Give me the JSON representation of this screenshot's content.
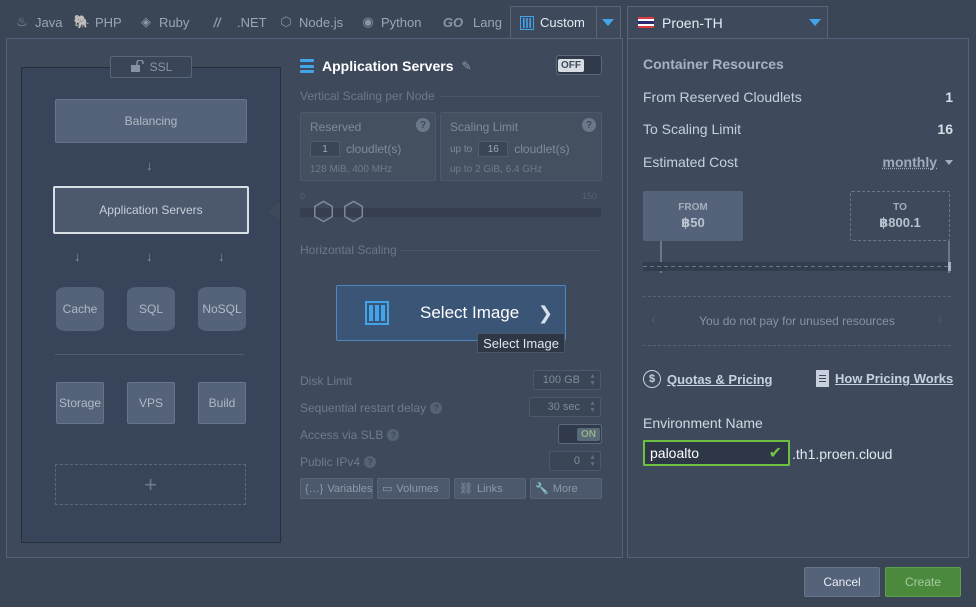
{
  "tabs": [
    {
      "label": "Java",
      "icon": "java-icon"
    },
    {
      "label": "PHP",
      "icon": "php-icon"
    },
    {
      "label": "Ruby",
      "icon": "ruby-icon"
    },
    {
      "label": ".NET",
      "icon": "dotnet-icon"
    },
    {
      "label": "Node.js",
      "icon": "nodejs-icon"
    },
    {
      "label": "Python",
      "icon": "python-icon"
    },
    {
      "label": "Lang",
      "icon": "go-icon",
      "icon_text": "GO"
    },
    {
      "label": "Custom",
      "icon": "columns-icon",
      "active": true
    }
  ],
  "topology": {
    "ssl_label": "SSL",
    "balancing_label": "Balancing",
    "app_servers_label": "Application Servers",
    "cache_label": "Cache",
    "sql_label": "SQL",
    "nosql_label": "NoSQL",
    "storage_label": "Storage",
    "vps_label": "VPS",
    "build_label": "Build",
    "add_symbol": "+"
  },
  "config": {
    "title": "Application Servers",
    "toggle_off": "OFF",
    "vertical_scaling_label": "Vertical Scaling per Node",
    "reserved": {
      "title": "Reserved",
      "value": "1",
      "unit": "cloudlet(s)",
      "sub": "128 MiB, 400 MHz"
    },
    "scaling_limit": {
      "title": "Scaling Limit",
      "prefix": "up to",
      "value": "16",
      "unit": "cloudlet(s)",
      "sub": "up to 2 GiB, 6.4 GHz"
    },
    "slider_min": "0",
    "slider_max": "150",
    "horizontal_scaling_label": "Horizontal Scaling",
    "select_image_label": "Select Image",
    "tooltip": "Select Image",
    "disk_limit_label": "Disk Limit",
    "disk_limit_value": "100 GB",
    "restart_delay_label": "Sequential restart delay",
    "restart_delay_value": "30 sec",
    "slb_label": "Access via SLB",
    "slb_toggle": "ON",
    "ipv4_label": "Public IPv4",
    "ipv4_value": "0",
    "buttons": {
      "variables": "Variables",
      "volumes": "Volumes",
      "links": "Links",
      "more": "More"
    }
  },
  "region": {
    "name": "Proen-TH",
    "flag_colors": [
      "#e03a3e",
      "#ffffff",
      "#2d2a6e",
      "#ffffff",
      "#e03a3e"
    ]
  },
  "resources": {
    "title": "Container Resources",
    "reserved_label": "From Reserved Cloudlets",
    "reserved_value": "1",
    "scaling_label": "To Scaling Limit",
    "scaling_value": "16",
    "cost_label": "Estimated Cost",
    "period": "monthly",
    "from_label": "FROM",
    "from_value": "฿50",
    "to_label": "TO",
    "to_value": "฿800.1",
    "unused_note": "You do not pay for unused resources",
    "quotas_link": "Quotas & Pricing",
    "pricing_link": "How Pricing Works"
  },
  "environment": {
    "label": "Environment Name",
    "value": "paloalto",
    "suffix": ".th1.proen.cloud"
  },
  "footer": {
    "cancel": "Cancel",
    "create": "Create"
  },
  "colors": {
    "accent": "#42a4ea",
    "success": "#6ec043",
    "create_button": "#4b8a3d"
  }
}
